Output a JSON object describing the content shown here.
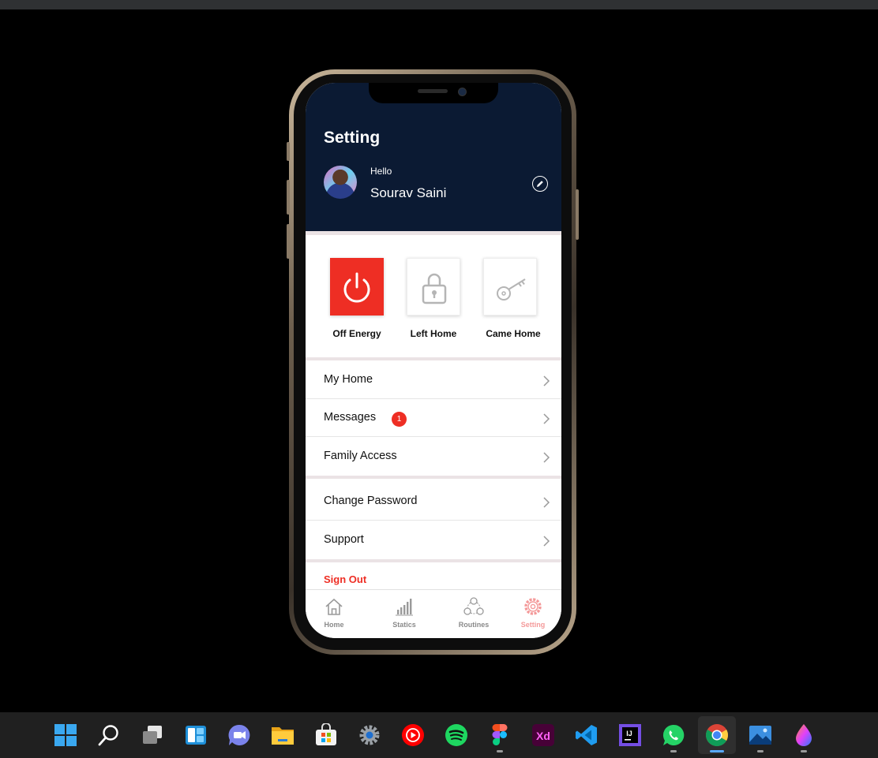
{
  "screen": {
    "title": "Setting",
    "profile": {
      "greeting": "Hello",
      "name": "Sourav Saini"
    },
    "quick_actions": [
      {
        "label": "Off Energy",
        "icon": "power-icon",
        "active": true
      },
      {
        "label": "Left Home",
        "icon": "lock-icon",
        "active": false
      },
      {
        "label": "Came Home",
        "icon": "key-icon",
        "active": false
      }
    ],
    "menu": [
      {
        "label": "My Home"
      },
      {
        "label": "Messages",
        "badge": "1"
      },
      {
        "label": "Family Access"
      },
      {
        "label": "Change Password"
      },
      {
        "label": "Support"
      }
    ],
    "signout_label": "Sign Out",
    "tabs": [
      {
        "label": "Home",
        "icon": "home-icon"
      },
      {
        "label": "Statics",
        "icon": "bar-chart-icon"
      },
      {
        "label": "Routines",
        "icon": "routines-icon"
      },
      {
        "label": "Setting",
        "icon": "gear-icon",
        "active": true
      }
    ],
    "colors": {
      "header_bg": "#0b1a33",
      "accent_red": "#ee2e24",
      "active_tab": "#f49a9a"
    }
  },
  "taskbar": {
    "items": [
      {
        "name": "windows-start-icon"
      },
      {
        "name": "search-icon"
      },
      {
        "name": "task-view-icon"
      },
      {
        "name": "widgets-icon"
      },
      {
        "name": "teams-chat-icon"
      },
      {
        "name": "file-explorer-icon"
      },
      {
        "name": "microsoft-store-icon"
      },
      {
        "name": "settings-icon"
      },
      {
        "name": "youtube-music-icon"
      },
      {
        "name": "spotify-icon"
      },
      {
        "name": "figma-icon"
      },
      {
        "name": "adobe-xd-icon",
        "text": "Xd"
      },
      {
        "name": "vscode-icon"
      },
      {
        "name": "intellij-icon",
        "text": "IJ"
      },
      {
        "name": "whatsapp-icon"
      },
      {
        "name": "chrome-icon",
        "active": true
      },
      {
        "name": "photos-icon"
      },
      {
        "name": "paint-icon"
      }
    ]
  }
}
